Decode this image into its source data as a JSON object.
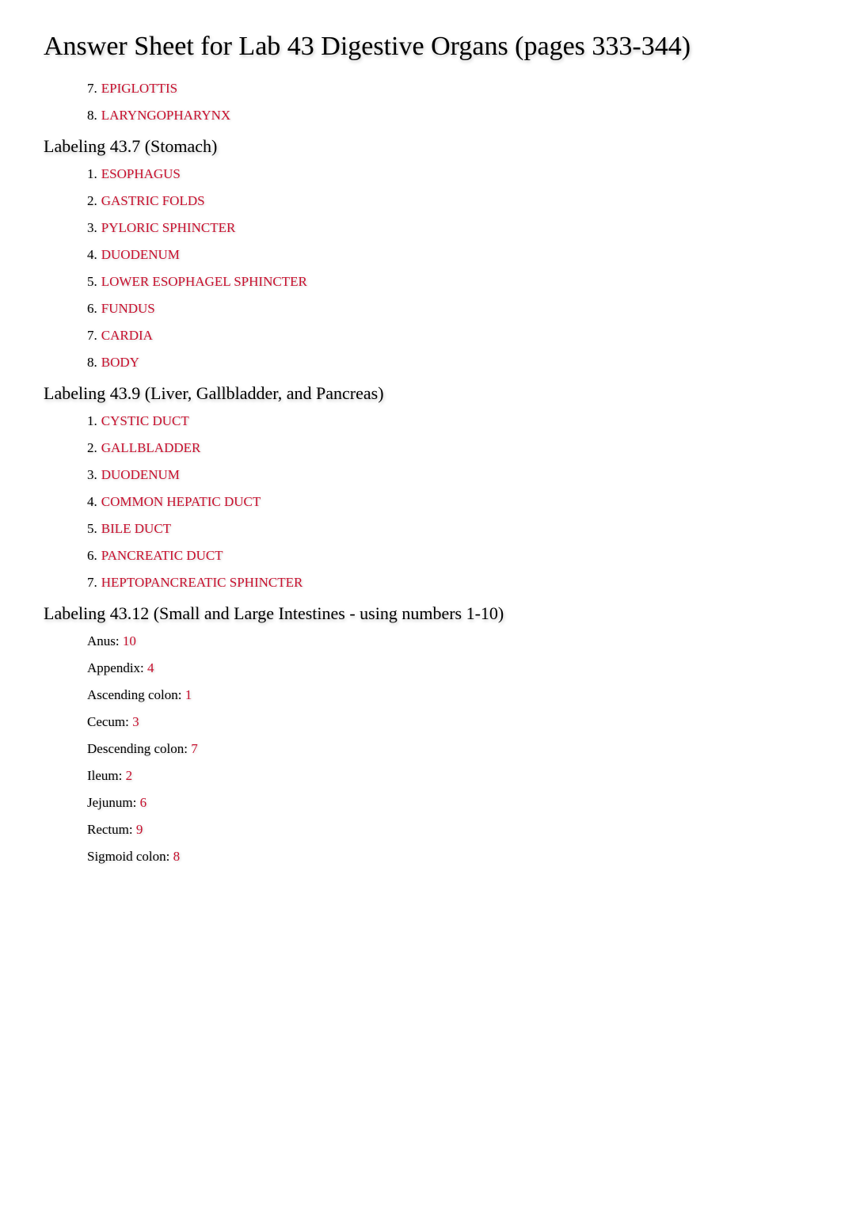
{
  "title": "Answer Sheet for Lab 43 Digestive Organs (pages 333-344)",
  "section0": {
    "items": [
      {
        "num": "7.",
        "answer": "EPIGLOTTIS"
      },
      {
        "num": "8.",
        "answer": "LARYNGOPHARYNX"
      }
    ]
  },
  "section1": {
    "heading": "Labeling 43.7 (Stomach)",
    "items": [
      {
        "num": "1.",
        "answer": "ESOPHAGUS"
      },
      {
        "num": "2.",
        "answer": "GASTRIC FOLDS"
      },
      {
        "num": "3.",
        "answer": "PYLORIC SPHINCTER"
      },
      {
        "num": "4.",
        "answer": "DUODENUM"
      },
      {
        "num": "5.",
        "answer": "LOWER ESOPHAGEL SPHINCTER"
      },
      {
        "num": "6.",
        "answer": "FUNDUS"
      },
      {
        "num": "7.",
        "answer": "CARDIA"
      },
      {
        "num": "8.",
        "answer": "BODY"
      }
    ]
  },
  "section2": {
    "heading": "Labeling 43.9 (Liver, Gallbladder, and Pancreas)",
    "items": [
      {
        "num": "1.",
        "answer": "CYSTIC DUCT"
      },
      {
        "num": "2.",
        "answer": "GALLBLADDER"
      },
      {
        "num": "3.",
        "answer": "DUODENUM"
      },
      {
        "num": "4.",
        "answer": "COMMON HEPATIC DUCT"
      },
      {
        "num": "5.",
        "answer": "BILE DUCT"
      },
      {
        "num": "6.",
        "answer": "PANCREATIC DUCT"
      },
      {
        "num": "7.",
        "answer": "HEPTOPANCREATIC SPHINCTER"
      }
    ]
  },
  "section3": {
    "heading": "Labeling 43.12 (Small and Large Intestines - using numbers 1-10)",
    "items": [
      {
        "label": "Anus: ",
        "value": "10"
      },
      {
        "label": "Appendix: ",
        "value": "4"
      },
      {
        "label": "Ascending colon: ",
        "value": "1"
      },
      {
        "label": "Cecum: ",
        "value": "3"
      },
      {
        "label": "Descending colon: ",
        "value": "7"
      },
      {
        "label": "Ileum: ",
        "value": "2"
      },
      {
        "label": "Jejunum: ",
        "value": "6"
      },
      {
        "label": "Rectum: ",
        "value": "9"
      },
      {
        "label": "Sigmoid colon: ",
        "value": "8"
      }
    ]
  }
}
